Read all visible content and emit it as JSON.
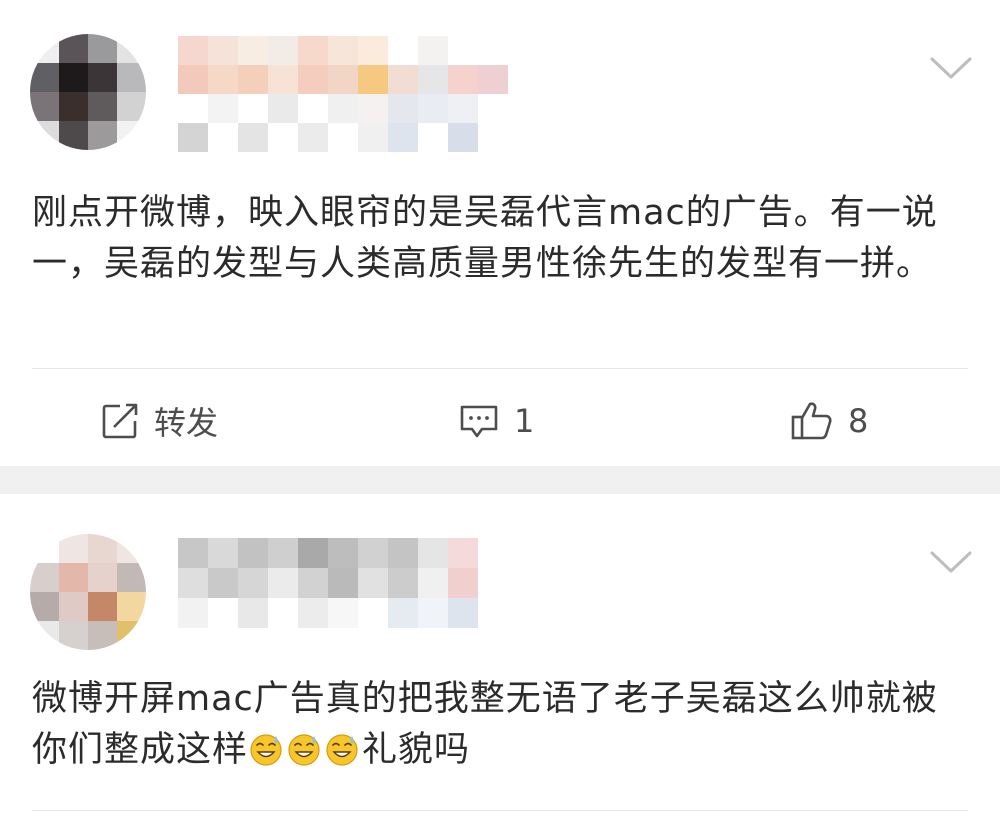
{
  "post1": {
    "text": "刚点开微博，映入眼帘的是吴磊代言mac的广告。有一说一，吴磊的发型与人类高质量男性徐先生的发型有一拼。",
    "menu_icon": "chevron-down-icon",
    "actions": {
      "repost": {
        "icon": "share-icon",
        "label": "转发"
      },
      "comment": {
        "icon": "comment-icon",
        "count": "1"
      },
      "like": {
        "icon": "thumbs-up-icon",
        "count": "8"
      }
    }
  },
  "post2": {
    "text_main": "微博开屏mac广告真的把我整无语了老子吴磊这么帅就被你们整成这样",
    "emoji": [
      "sweat-smile-emoji",
      "sweat-smile-emoji",
      "sweat-smile-emoji"
    ],
    "text_tail": "礼貌吗",
    "menu_icon": "chevron-down-icon"
  },
  "colors": {
    "text": "#2b2b2b",
    "icon_gray": "#4d4d4d",
    "separator": "#f0f0f0",
    "emoji_yellow": "#f7c62b"
  }
}
